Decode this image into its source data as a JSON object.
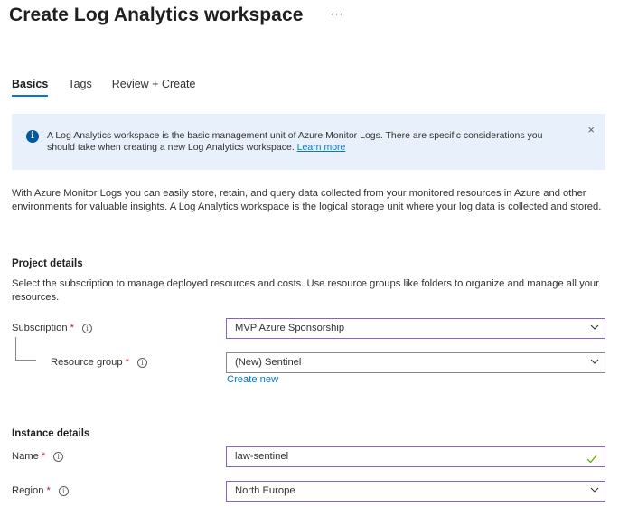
{
  "header": {
    "title": "Create Log Analytics workspace",
    "more_label": "···"
  },
  "tabs": [
    {
      "label": "Basics",
      "active": true
    },
    {
      "label": "Tags",
      "active": false
    },
    {
      "label": "Review + Create",
      "active": false
    }
  ],
  "info_banner": {
    "text": "A Log Analytics workspace is the basic management unit of Azure Monitor Logs. There are specific considerations you should take when creating a new Log Analytics workspace.",
    "link": "Learn more",
    "close": "×"
  },
  "description": "With Azure Monitor Logs you can easily store, retain, and query data collected from your monitored resources in Azure and other environments for valuable insights. A Log Analytics workspace is the logical storage unit where your log data is collected and stored.",
  "project_details": {
    "heading": "Project details",
    "description": "Select the subscription to manage deployed resources and costs. Use resource groups like folders to organize and manage all your resources.",
    "subscription": {
      "label": "Subscription",
      "required_mark": "*",
      "value": "MVP Azure Sponsorship"
    },
    "resource_group": {
      "label": "Resource group",
      "required_mark": "*",
      "value": "(New) Sentinel",
      "create_new": "Create new"
    }
  },
  "instance_details": {
    "heading": "Instance details",
    "name": {
      "label": "Name",
      "required_mark": "*",
      "value": "law-sentinel"
    },
    "region": {
      "label": "Region",
      "required_mark": "*",
      "value": "North Europe"
    }
  },
  "icons": {
    "info": "info-circle-icon",
    "close": "close-icon",
    "chevron": "chevron-down-icon",
    "check": "checkmark-icon"
  },
  "colors": {
    "accent": "#0078d4",
    "banner_bg": "#e8f1fb",
    "focus_border": "#8764b8",
    "required": "#a4262c",
    "valid": "#57a300"
  }
}
